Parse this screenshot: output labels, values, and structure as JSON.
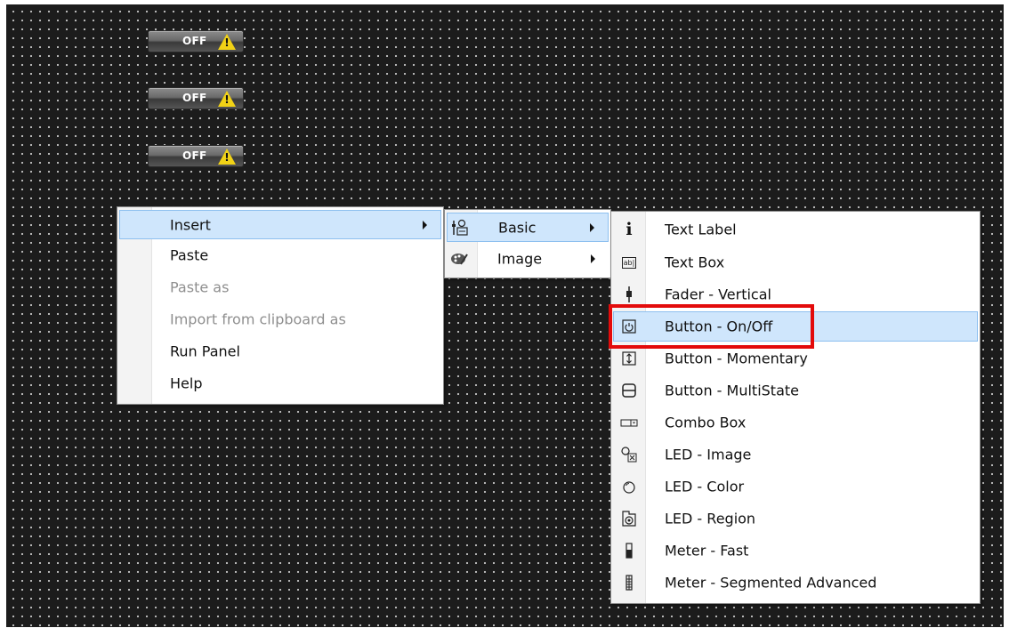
{
  "canvas": {
    "toggles": [
      {
        "label": "OFF",
        "icon": "warning-icon",
        "mark": "!"
      },
      {
        "label": "OFF",
        "icon": "warning-icon",
        "mark": "!"
      },
      {
        "label": "OFF",
        "icon": "warning-icon",
        "mark": "!"
      }
    ]
  },
  "context_menu": {
    "items": [
      {
        "label": "Insert",
        "enabled": true,
        "has_submenu": true,
        "highlighted": true
      },
      {
        "label": "Paste",
        "enabled": true
      },
      {
        "label": "Paste as",
        "enabled": false
      },
      {
        "label": "Import from clipboard as",
        "enabled": false
      },
      {
        "label": "Run Panel",
        "enabled": true
      },
      {
        "label": "Help",
        "enabled": true
      }
    ]
  },
  "insert_submenu": {
    "items": [
      {
        "label": "Basic",
        "icon": "basic-controls-icon",
        "has_submenu": true,
        "highlighted": true
      },
      {
        "label": "Image",
        "icon": "palette-icon",
        "has_submenu": true
      }
    ]
  },
  "basic_submenu": {
    "items": [
      {
        "label": "Text Label",
        "icon": "text-label-icon",
        "glyph": "i"
      },
      {
        "label": "Text Box",
        "icon": "text-box-icon",
        "glyph": "ab|"
      },
      {
        "label": "Fader - Vertical",
        "icon": "fader-vertical-icon"
      },
      {
        "label": "Button - On/Off",
        "icon": "power-button-icon",
        "highlighted": true
      },
      {
        "label": "Button - Momentary",
        "icon": "momentary-button-icon"
      },
      {
        "label": "Button - MultiState",
        "icon": "multistate-button-icon"
      },
      {
        "label": "Combo Box",
        "icon": "combo-box-icon"
      },
      {
        "label": "LED - Image",
        "icon": "led-image-icon"
      },
      {
        "label": "LED - Color",
        "icon": "led-color-icon"
      },
      {
        "label": "LED - Region",
        "icon": "led-region-icon"
      },
      {
        "label": "Meter - Fast",
        "icon": "meter-fast-icon"
      },
      {
        "label": "Meter - Segmented Advanced",
        "icon": "meter-segmented-icon"
      }
    ]
  },
  "colors": {
    "highlight_bg": "#cfe6fc",
    "highlight_border": "#8ec0ef",
    "annotation_red": "#e30b0b",
    "canvas_bg": "#1c1c1c"
  }
}
